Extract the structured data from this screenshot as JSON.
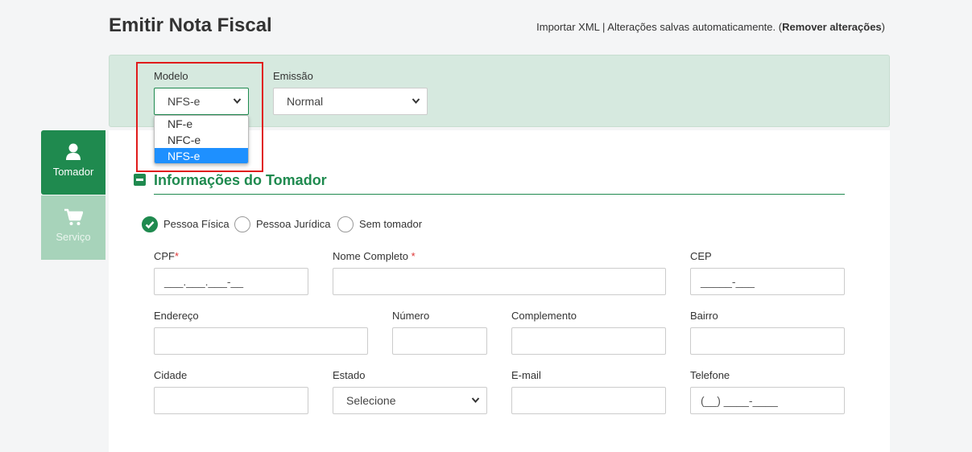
{
  "page": {
    "title": "Emitir Nota Fiscal",
    "import_xml": "Importar XML",
    "separator": " | ",
    "autosave_text": "Alterações salvas automaticamente. (",
    "remove_changes": "Remover alterações",
    "close_paren": ")"
  },
  "model_bar": {
    "modelo_label": "Modelo",
    "modelo_value": "NFS-e",
    "modelo_options": [
      "NF-e",
      "NFC-e",
      "NFS-e"
    ],
    "emissao_label": "Emissão",
    "emissao_value": "Normal"
  },
  "sidebar": {
    "items": [
      {
        "label": "Tomador",
        "icon": "user-icon"
      },
      {
        "label": "Serviço",
        "icon": "cart-icon"
      }
    ]
  },
  "section": {
    "title": "Informações do Tomador"
  },
  "person_type": {
    "options": [
      "Pessoa Física",
      "Pessoa Jurídica",
      "Sem tomador"
    ],
    "selected": "Pessoa Física"
  },
  "form": {
    "cpf_label": "CPF",
    "cpf_mask": "___.___.___-__",
    "nome_label": "Nome Completo",
    "cep_label": "CEP",
    "cep_mask": "_____-___",
    "endereco_label": "Endereço",
    "numero_label": "Número",
    "complemento_label": "Complemento",
    "bairro_label": "Bairro",
    "cidade_label": "Cidade",
    "estado_label": "Estado",
    "estado_value": "Selecione",
    "email_label": "E-mail",
    "telefone_label": "Telefone",
    "telefone_mask": "(__) ____-____",
    "required_mark": "*"
  },
  "colors": {
    "accent": "#1f8a4f",
    "highlight": "#e01b1b",
    "selected_option": "#1e90ff"
  }
}
